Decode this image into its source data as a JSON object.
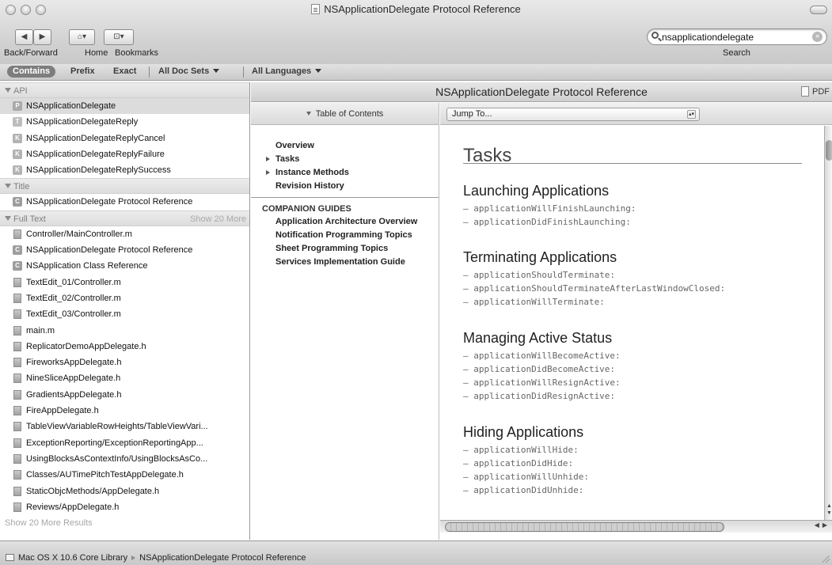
{
  "window": {
    "title": "NSApplicationDelegate Protocol Reference"
  },
  "toolbar": {
    "back_forward_label": "Back/Forward",
    "home_label": "Home",
    "bookmarks_label": "Bookmarks",
    "search_label": "Search",
    "search_value": "nsapplicationdelegate",
    "back_icon": "◀",
    "forward_icon": "▶",
    "home_icon": "⌂▾",
    "bookmarks_icon": "⊡▾"
  },
  "filterbar": {
    "contains": "Contains",
    "prefix": "Prefix",
    "exact": "Exact",
    "doc_sets": "All Doc Sets",
    "languages": "All Languages"
  },
  "sidebar": {
    "api_header": "API",
    "api_items": [
      {
        "badge": "P",
        "label": "NSApplicationDelegate",
        "selected": true
      },
      {
        "badge": "T",
        "label": "NSApplicationDelegateReply"
      },
      {
        "badge": "K",
        "label": "NSApplicationDelegateReplyCancel"
      },
      {
        "badge": "K",
        "label": "NSApplicationDelegateReplyFailure"
      },
      {
        "badge": "K",
        "label": "NSApplicationDelegateReplySuccess"
      }
    ],
    "title_header": "Title",
    "title_items": [
      {
        "badge": "C",
        "label": "NSApplicationDelegate Protocol Reference"
      }
    ],
    "fulltext_header": "Full Text",
    "fulltext_more": "Show 20 More",
    "fulltext_items": [
      {
        "badge": "file",
        "label": "Controller/MainController.m"
      },
      {
        "badge": "C",
        "label": "NSApplicationDelegate Protocol Reference"
      },
      {
        "badge": "C",
        "label": "NSApplication Class Reference"
      },
      {
        "badge": "file",
        "label": "TextEdit_01/Controller.m"
      },
      {
        "badge": "file",
        "label": "TextEdit_02/Controller.m"
      },
      {
        "badge": "file",
        "label": "TextEdit_03/Controller.m"
      },
      {
        "badge": "file",
        "label": "main.m"
      },
      {
        "badge": "file",
        "label": "ReplicatorDemoAppDelegate.h"
      },
      {
        "badge": "file",
        "label": "FireworksAppDelegate.h"
      },
      {
        "badge": "file",
        "label": "NineSliceAppDelegate.h"
      },
      {
        "badge": "file",
        "label": "GradientsAppDelegate.h"
      },
      {
        "badge": "file",
        "label": "FireAppDelegate.h"
      },
      {
        "badge": "file",
        "label": "TableViewVariableRowHeights/TableViewVari..."
      },
      {
        "badge": "file",
        "label": "ExceptionReporting/ExceptionReportingApp..."
      },
      {
        "badge": "file",
        "label": "UsingBlocksAsContextInfo/UsingBlocksAsCo..."
      },
      {
        "badge": "file",
        "label": "Classes/AUTimePitchTestAppDelegate.h"
      },
      {
        "badge": "file",
        "label": "StaticObjcMethods/AppDelegate.h"
      },
      {
        "badge": "file",
        "label": "Reviews/AppDelegate.h"
      }
    ],
    "show_more_results": "Show 20 More Results"
  },
  "content": {
    "header_title": "NSApplicationDelegate Protocol Reference",
    "pdf_label": "PDF",
    "toc": {
      "header": "Table of Contents",
      "items": [
        {
          "label": "Overview",
          "arrow": false
        },
        {
          "label": "Tasks",
          "arrow": true
        },
        {
          "label": "Instance Methods",
          "arrow": true
        },
        {
          "label": "Revision History",
          "arrow": false
        }
      ],
      "companion_header": "COMPANION GUIDES",
      "guides": [
        "Application Architecture Overview",
        "Notification Programming Topics",
        "Sheet Programming Topics",
        "Services Implementation Guide"
      ]
    },
    "jump_to": "Jump To...",
    "doc_title": "Tasks",
    "sections": [
      {
        "heading": "Launching Applications",
        "methods": [
          "– applicationWillFinishLaunching:",
          "– applicationDidFinishLaunching:"
        ]
      },
      {
        "heading": "Terminating Applications",
        "methods": [
          "– applicationShouldTerminate:",
          "– applicationShouldTerminateAfterLastWindowClosed:",
          "– applicationWillTerminate:"
        ]
      },
      {
        "heading": "Managing Active Status",
        "methods": [
          "– applicationWillBecomeActive:",
          "– applicationDidBecomeActive:",
          "– applicationWillResignActive:",
          "– applicationDidResignActive:"
        ]
      },
      {
        "heading": "Hiding Applications",
        "methods": [
          "– applicationWillHide:",
          "– applicationDidHide:",
          "– applicationWillUnhide:",
          "– applicationDidUnhide:"
        ]
      }
    ]
  },
  "statusbar": {
    "path": [
      "Mac OS X 10.6 Core Library",
      "NSApplicationDelegate Protocol Reference"
    ]
  }
}
